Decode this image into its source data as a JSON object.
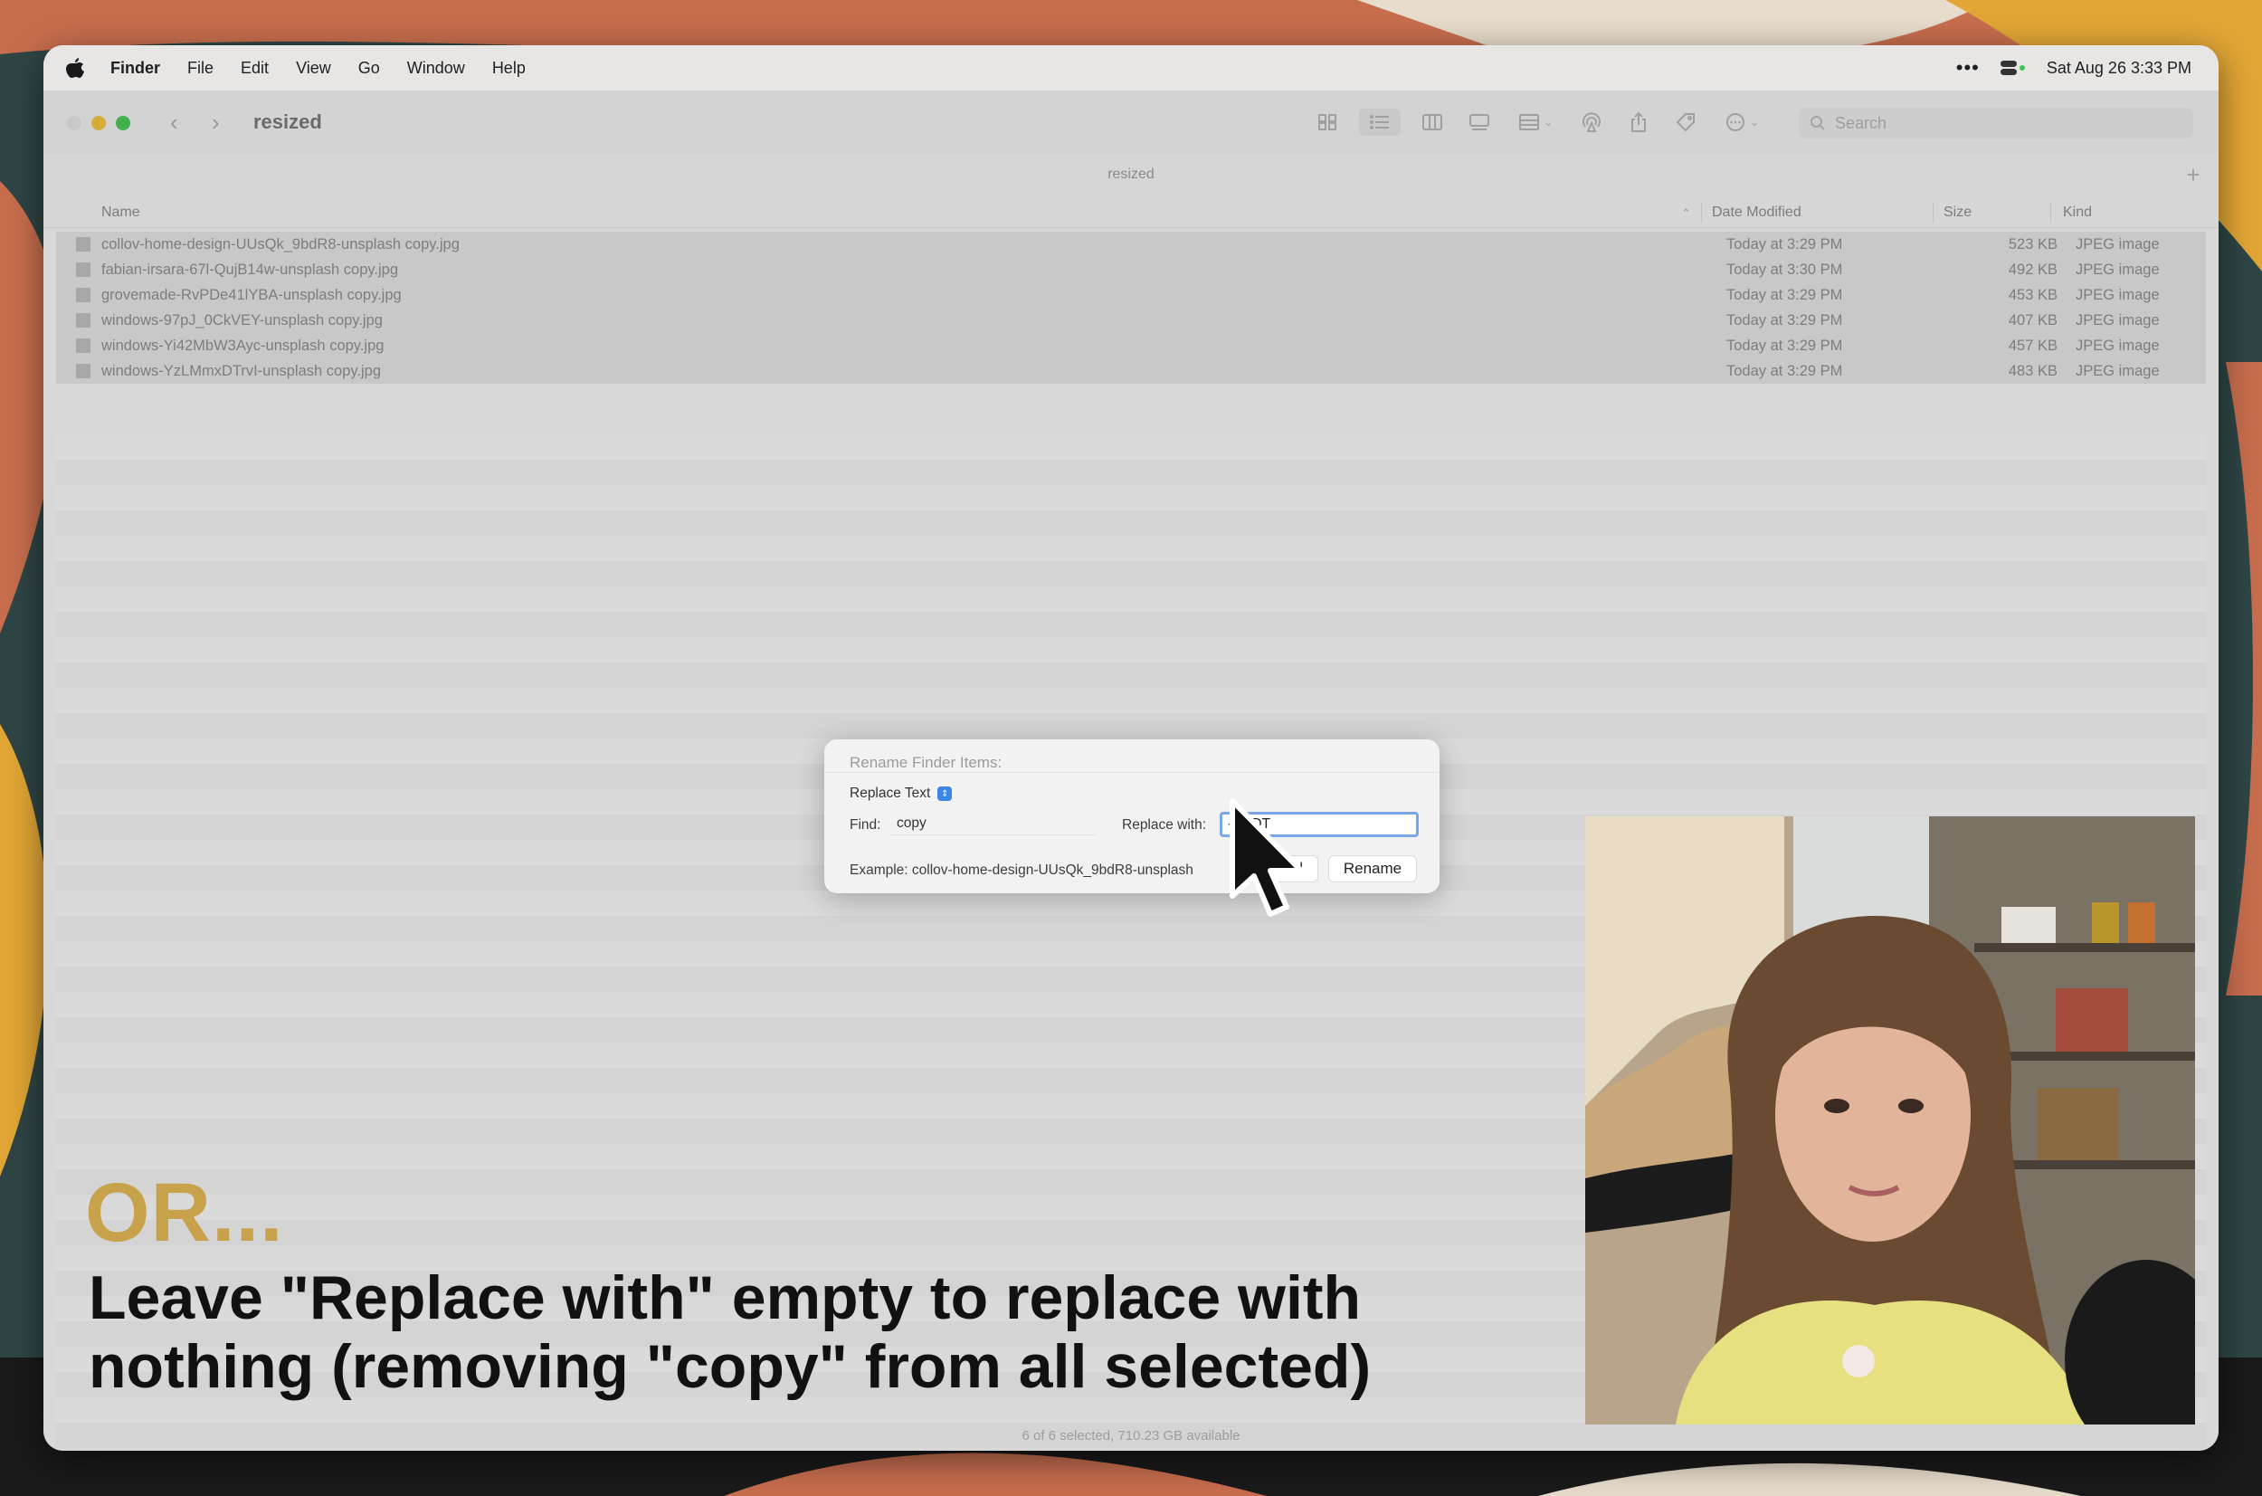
{
  "menubar": {
    "app": "Finder",
    "menus": [
      "File",
      "Edit",
      "View",
      "Go",
      "Window",
      "Help"
    ],
    "datetime": "Sat Aug 26  3:33 PM"
  },
  "window": {
    "title": "resized",
    "path_title": "resized",
    "search_placeholder": "Search",
    "columns": {
      "name": "Name",
      "date": "Date Modified",
      "size": "Size",
      "kind": "Kind"
    },
    "files": [
      {
        "name": "collov-home-design-UUsQk_9bdR8-unsplash copy.jpg",
        "date": "Today at 3:29 PM",
        "size": "523 KB",
        "kind": "JPEG image"
      },
      {
        "name": "fabian-irsara-67l-QujB14w-unsplash copy.jpg",
        "date": "Today at 3:30 PM",
        "size": "492 KB",
        "kind": "JPEG image"
      },
      {
        "name": "grovemade-RvPDe41lYBA-unsplash copy.jpg",
        "date": "Today at 3:29 PM",
        "size": "453 KB",
        "kind": "JPEG image"
      },
      {
        "name": "windows-97pJ_0CkVEY-unsplash copy.jpg",
        "date": "Today at 3:29 PM",
        "size": "407 KB",
        "kind": "JPEG image"
      },
      {
        "name": "windows-Yi42MbW3Ayc-unsplash copy.jpg",
        "date": "Today at 3:29 PM",
        "size": "457 KB",
        "kind": "JPEG image"
      },
      {
        "name": "windows-YzLMmxDTrvI-unsplash copy.jpg",
        "date": "Today at 3:29 PM",
        "size": "483 KB",
        "kind": "JPEG image"
      }
    ],
    "status": "6 of 6 selected, 710.23 GB available"
  },
  "dialog": {
    "title": "Rename Finder Items:",
    "mode": "Replace Text",
    "find_label": "Find:",
    "find_value": "copy",
    "replace_label": "Replace with:",
    "replace_value": "- LTDT",
    "example": "Example: collov-home-design-UUsQk_9bdR8-unsplash",
    "cancel_label": "Cancel",
    "rename_label": "Rename"
  },
  "caption": {
    "heading": "OR...",
    "line1": "Leave \"Replace with\" empty to replace with",
    "line2": "nothing (removing \"copy\" from all selected)"
  },
  "colors": {
    "caption_heading": "#c8a24a",
    "accent_blue": "#3b86e6"
  }
}
